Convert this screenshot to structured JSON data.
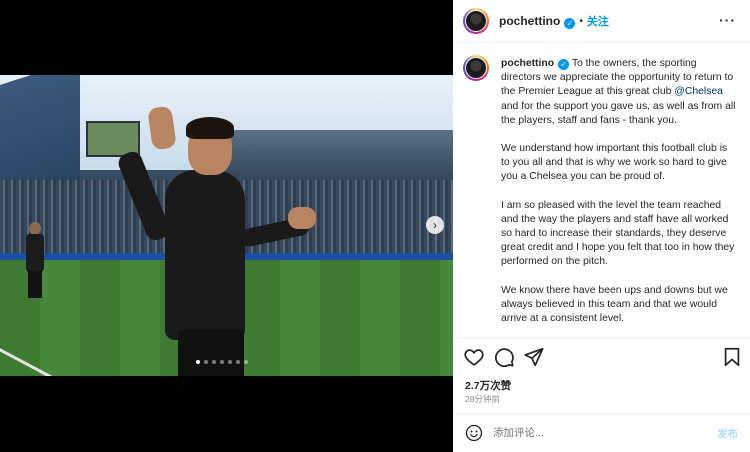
{
  "header": {
    "username": "pochettino",
    "separator": "•",
    "follow_label": "关注",
    "more_label": "···"
  },
  "caption": {
    "username": "pochettino",
    "p1_a": "To the owners, the sporting directors we appreciate the opportunity to return to the Premier League at this great club",
    "mention": "@Chelsea",
    "p1_b": "and for the support you gave us, as well as from all the players, staff and fans - thank you.",
    "p2": "We understand how important this football club is to you all and that is why we work so hard to give you a Chelsea you can be proud of.",
    "p3": "I am so pleased with the level the team reached and the way the players and staff have all worked so hard to increase their standards, they deserve great credit and I hope you felt that too in how they performed on the pitch.",
    "p4": "We know there have been ups and downs but we always believed in this team and that we would arrive at a consistent level."
  },
  "media": {
    "next_label": "›",
    "slide_count": 7,
    "active_slide": 1
  },
  "stats": {
    "likes": "2.7万次赞",
    "time": "28分钟前"
  },
  "comment": {
    "placeholder": "添加评论...",
    "post_label": "发布"
  },
  "colors": {
    "accent": "#0095f6",
    "mention": "#00376b",
    "post_disabled": "#b3dbff",
    "muted": "#8e8e8e"
  },
  "icons": [
    "verified-badge-icon",
    "more-icon",
    "like-heart-icon",
    "comment-icon",
    "share-icon",
    "save-bookmark-icon",
    "emoji-icon",
    "next-arrow-icon"
  ]
}
